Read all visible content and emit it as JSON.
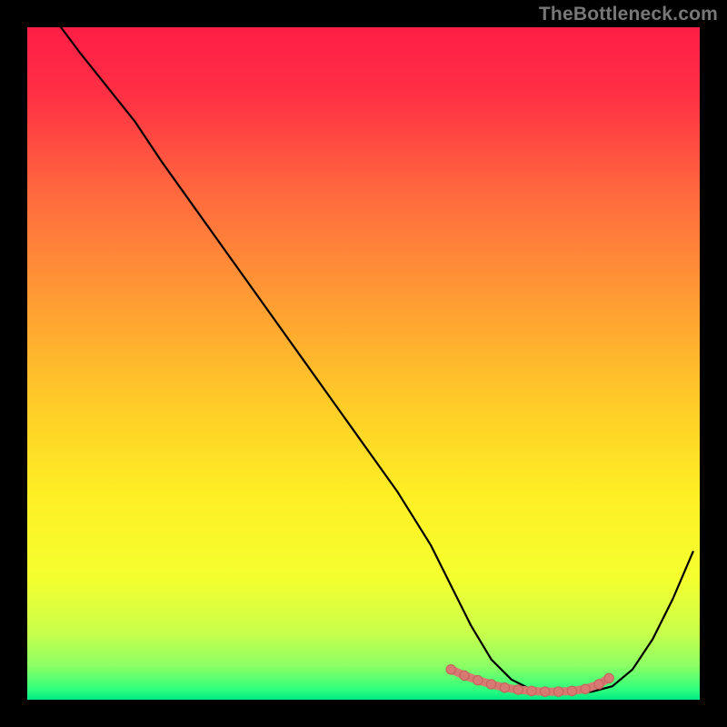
{
  "watermark": "TheBottleneck.com",
  "colors": {
    "border": "#000000",
    "gradient_stops": [
      {
        "offset": 0.0,
        "color": "#ff1e46"
      },
      {
        "offset": 0.1,
        "color": "#ff3045"
      },
      {
        "offset": 0.25,
        "color": "#ff6a3e"
      },
      {
        "offset": 0.4,
        "color": "#ff9a34"
      },
      {
        "offset": 0.55,
        "color": "#ffc928"
      },
      {
        "offset": 0.7,
        "color": "#fef024"
      },
      {
        "offset": 0.82,
        "color": "#f4ff2f"
      },
      {
        "offset": 0.9,
        "color": "#c9ff4a"
      },
      {
        "offset": 0.95,
        "color": "#8bff65"
      },
      {
        "offset": 0.985,
        "color": "#2fff7d"
      },
      {
        "offset": 1.0,
        "color": "#00e884"
      }
    ],
    "curve": "#000000",
    "marker_fill": "#d77a73",
    "marker_stroke": "#c55f58"
  },
  "chart_data": {
    "type": "line",
    "title": "",
    "xlabel": "",
    "ylabel": "",
    "xlim": [
      0,
      100
    ],
    "ylim": [
      0,
      100
    ],
    "series": [
      {
        "name": "bottleneck-curve",
        "x": [
          5,
          8,
          12,
          16,
          20,
          25,
          30,
          35,
          40,
          45,
          50,
          55,
          60,
          63,
          66,
          69,
          72,
          75,
          78,
          81,
          84,
          87,
          90,
          93,
          96,
          99
        ],
        "y": [
          100,
          96,
          91,
          86,
          80,
          73,
          66,
          59,
          52,
          45,
          38,
          31,
          23,
          17,
          11,
          6,
          3,
          1.5,
          1,
          1,
          1.2,
          2,
          4.5,
          9,
          15,
          22
        ]
      }
    ],
    "markers": {
      "name": "highlight-segment",
      "x": [
        63,
        65,
        67,
        69,
        71,
        73,
        75,
        77,
        79,
        81,
        83,
        85,
        86.5
      ],
      "y": [
        4.5,
        3.6,
        2.9,
        2.3,
        1.8,
        1.5,
        1.3,
        1.2,
        1.2,
        1.3,
        1.6,
        2.3,
        3.2
      ]
    }
  }
}
